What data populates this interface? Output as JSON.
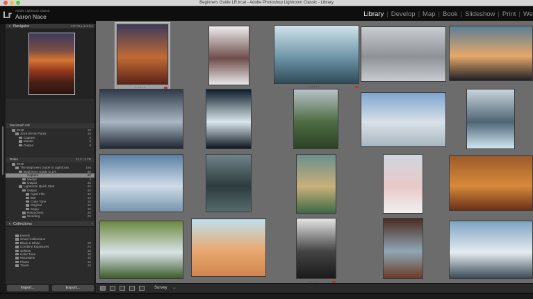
{
  "window": {
    "title": "Beginners Guide LR.lrcat - Adobe Photoshop Lightroom Classic - Library"
  },
  "identity": {
    "logo": "Lr",
    "product": "Adobe Lightroom Classic",
    "user": "Aaron Nace"
  },
  "modules": [
    {
      "label": "Library",
      "active": true
    },
    {
      "label": "Develop"
    },
    {
      "label": "Map"
    },
    {
      "label": "Book"
    },
    {
      "label": "Slideshow"
    },
    {
      "label": "Print"
    },
    {
      "label": "We"
    }
  ],
  "navigator": {
    "title": "Navigator",
    "zoom": "FIT   FILL   1:1   3:1"
  },
  "folders_volume1": {
    "name": "Macintosh HD",
    "value": ""
  },
  "folders_list1": [
    {
      "indent": 1,
      "label": "2019",
      "num": "18"
    },
    {
      "indent": 2,
      "label": "2019-05-08 Plants",
      "num": "18"
    },
    {
      "indent": 3,
      "label": "Capture",
      "num": "0"
    },
    {
      "indent": 3,
      "label": "Master",
      "num": "0"
    },
    {
      "indent": 3,
      "label": "Output",
      "num": "0"
    }
  ],
  "folders_volume2": {
    "name": "Robin",
    "value": "11.2 / 2 TB"
  },
  "folders_list2": [
    {
      "indent": 1,
      "label": "2019",
      "num": ""
    },
    {
      "indent": 2,
      "label": "The Beginners Guide to Lightroom",
      "num": "166"
    },
    {
      "indent": 3,
      "label": "Beginners Guide to LR",
      "num": "60"
    },
    {
      "indent": 4,
      "label": "Capture",
      "num": "52",
      "selected": true
    },
    {
      "indent": 4,
      "label": "Master",
      "num": "4"
    },
    {
      "indent": 4,
      "label": "Output",
      "num": "32"
    },
    {
      "indent": 3,
      "label": "Lightroom Quick Start",
      "num": "46"
    },
    {
      "indent": 4,
      "label": "Output",
      "num": "46"
    },
    {
      "indent": 5,
      "label": "Aged Film",
      "num": "10"
    },
    {
      "indent": 5,
      "label": "BW",
      "num": "10"
    },
    {
      "indent": 5,
      "label": "Color Tone",
      "num": "10"
    },
    {
      "indent": 5,
      "label": "Original",
      "num": "10"
    },
    {
      "indent": 5,
      "label": "Sepia",
      "num": "10"
    },
    {
      "indent": 4,
      "label": "Retouchers",
      "num": "25"
    },
    {
      "indent": 4,
      "label": "Wedding",
      "num": "25"
    }
  ],
  "collections": {
    "title": "Collections"
  },
  "collections_list": [
    {
      "label": "Events",
      "num": ""
    },
    {
      "label": "Smart Collections",
      "num": ""
    },
    {
      "label": "Black & White",
      "num": "28"
    },
    {
      "label": "Combine Exposures",
      "num": "24"
    },
    {
      "label": "Selects",
      "num": "18"
    },
    {
      "label": "Color Tone",
      "num": "18"
    },
    {
      "label": "Mountains",
      "num": "10"
    },
    {
      "label": "Plants",
      "num": "10"
    },
    {
      "label": "Travel",
      "num": "10"
    }
  ],
  "buttons": {
    "import": "Import...",
    "export": "Export..."
  },
  "toolbar": {
    "sort_label": "Survey"
  },
  "colors": {
    "grid_bg": "#6c6c6c",
    "panel_bg": "#2b2b2b",
    "reject_badge": "#c23131",
    "active_module": "#f2f2f2"
  },
  "photos": [
    {
      "name": "desert-badlands-sunset",
      "colors": [
        "#3d3b5c",
        "#c26a34",
        "#5a2418"
      ],
      "stars": "• • • • •",
      "badge": true,
      "selected": true
    },
    {
      "name": "snowy-rock-outcrop",
      "colors": [
        "#ececec",
        "#6e4d4b",
        "#e8e8e8"
      ]
    },
    {
      "name": "foggy-forest-sun-rays",
      "colors": [
        "#cfe3ea",
        "#6e95a8",
        "#2f4a58"
      ],
      "stars": "• • • • •",
      "badge": true
    },
    {
      "name": "aerial-snowy-trees",
      "colors": [
        "#c9cdd0",
        "#8e9296",
        "#c8cbcf"
      ]
    },
    {
      "name": "haystack-rock-sunset",
      "colors": [
        "#5d7e94",
        "#e5a86b",
        "#1f1f26"
      ]
    },
    {
      "name": "dark-mountain-peak",
      "colors": [
        "#2f3b4a",
        "#a9b6c4",
        "#1e2631"
      ]
    },
    {
      "name": "black-white-ice",
      "colors": [
        "#0d1c2a",
        "#d9e6ec",
        "#0d1620"
      ]
    },
    {
      "name": "misty-green-cliffs",
      "colors": [
        "#b9c2c7",
        "#4e6b43",
        "#2c4226"
      ]
    },
    {
      "name": "frosted-trees-field",
      "colors": [
        "#7fa6cf",
        "#d8e1e8",
        "#a9b6bf"
      ]
    },
    {
      "name": "icebergs-mountain",
      "colors": [
        "#c9d4dc",
        "#4f6574",
        "#cfe6f2"
      ]
    },
    {
      "name": "snowy-mountain-clouds",
      "colors": [
        "#5a7fa3",
        "#cfdce8",
        "#7793ad"
      ]
    },
    {
      "name": "waterfall-cliffs",
      "colors": [
        "#6f8389",
        "#2d3c3e",
        "#556a6c"
      ]
    },
    {
      "name": "coastal-cove",
      "colors": [
        "#6b8f8c",
        "#c9b07a",
        "#3c6a46"
      ]
    },
    {
      "name": "snowy-pines",
      "colors": [
        "#cfd6de",
        "#e8c9c8",
        "#f0f0f0"
      ]
    },
    {
      "name": "red-canyon-hoodoos",
      "colors": [
        "#9d5b2a",
        "#d78a3a",
        "#6a3019"
      ]
    },
    {
      "name": "plitvice-waterfalls",
      "colors": [
        "#6c8a3f",
        "#d9e3e6",
        "#3d5c2c"
      ]
    },
    {
      "name": "desert-sand-dunes",
      "colors": [
        "#bfe0ee",
        "#e8a86f",
        "#d0864e"
      ]
    },
    {
      "name": "black-white-tree",
      "colors": [
        "#e5e5e5",
        "#444444",
        "#1a1a1a"
      ],
      "stars": "• • • • •",
      "badge": true
    },
    {
      "name": "rock-arch-lake",
      "colors": [
        "#4a2b21",
        "#8fa7b5",
        "#6b3a26"
      ]
    },
    {
      "name": "snowy-mountain-range",
      "colors": [
        "#7ea4c3",
        "#e6ecf0",
        "#3a4a56"
      ]
    }
  ]
}
